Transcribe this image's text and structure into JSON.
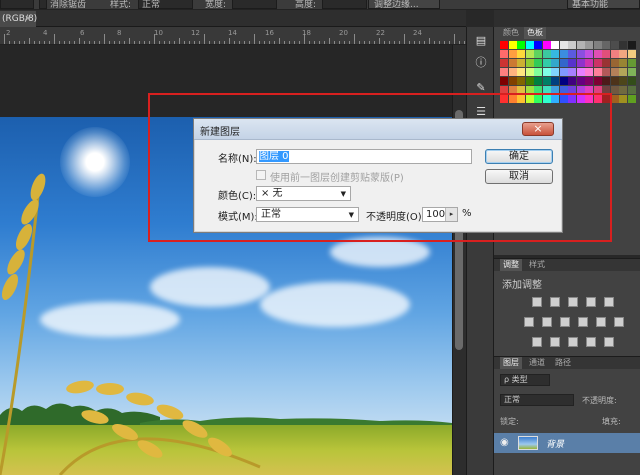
{
  "options_bar": {
    "items": [
      "消除锯齿",
      "样式:",
      "正常",
      "宽度:",
      "高度:",
      "调整边缘...",
      "基本功能"
    ]
  },
  "document": {
    "tab_label": "(RGB/8)",
    "tab_close": "×"
  },
  "ruler": {
    "labels": [
      "2",
      "4",
      "6",
      "8",
      "10",
      "12",
      "14",
      "16",
      "18",
      "20",
      "22",
      "24"
    ]
  },
  "swatch_panel": {
    "tabs": [
      "颜色",
      "色板"
    ],
    "colors": [
      "#ff0000",
      "#ffff00",
      "#00ff00",
      "#00ffff",
      "#0000ff",
      "#ff00ff",
      "#ffffff",
      "#e6e6e6",
      "#cccccc",
      "#b3b3b3",
      "#999999",
      "#808080",
      "#666666",
      "#4d4d4d",
      "#333333",
      "#1a1a1a",
      "#ff6b6b",
      "#ff9f40",
      "#ffd93b",
      "#b5e655",
      "#5fd35f",
      "#3cc8a0",
      "#36b8e0",
      "#3b8de0",
      "#5b5be0",
      "#8b4fe0",
      "#c04fe0",
      "#e04fb5",
      "#e04f7a",
      "#f28080",
      "#f2a680",
      "#f2cc80",
      "#cc3333",
      "#cc7a33",
      "#ccb033",
      "#8fcc33",
      "#33cc57",
      "#33cca8",
      "#33a8cc",
      "#3366cc",
      "#5733cc",
      "#8f33cc",
      "#cc33b0",
      "#cc3366",
      "#993333",
      "#996633",
      "#998533",
      "#669933",
      "#ff8080",
      "#ffb380",
      "#ffe680",
      "#d4ff80",
      "#80ff9c",
      "#80ffe6",
      "#80d4ff",
      "#8099ff",
      "#a680ff",
      "#e680ff",
      "#ff80d4",
      "#ff8099",
      "#b35959",
      "#b38059",
      "#b3a659",
      "#80b359",
      "#800000",
      "#804000",
      "#806600",
      "#408000",
      "#008040",
      "#008066",
      "#004080",
      "#000080",
      "#400080",
      "#660080",
      "#800066",
      "#800033",
      "#4d1a1a",
      "#4d331a",
      "#4d461a",
      "#334d1a",
      "#e04040",
      "#e08040",
      "#e0c040",
      "#a0e040",
      "#40e070",
      "#40e0c0",
      "#40a0e0",
      "#4060e0",
      "#7040e0",
      "#b040e0",
      "#e040c0",
      "#e04080",
      "#704040",
      "#705840",
      "#706a40",
      "#587040",
      "#ff3030",
      "#ff8030",
      "#ffc030",
      "#c0ff30",
      "#30ff60",
      "#30ffd0",
      "#30b0ff",
      "#3050ff",
      "#8030ff",
      "#d030ff",
      "#ff30c0",
      "#ff3070",
      "#a02020",
      "#a06020",
      "#a09020",
      "#60a020"
    ]
  },
  "adjust_panel": {
    "tabs": [
      "调整",
      "样式"
    ],
    "title": "添加调整"
  },
  "layers_panel": {
    "tabs": [
      "图层",
      "通道",
      "路径"
    ],
    "filter_label": "ρ 类型",
    "blend_mode": "正常",
    "opacity_label": "不透明度:",
    "lock_label": "锁定:",
    "fill_label": "填充:",
    "layer_name": "背景"
  },
  "dialog": {
    "title": "新建图层",
    "close": "×",
    "name_label": "名称(N):",
    "name_value": "图层 0",
    "clip_label": "使用前一图层创建剪贴蒙版(P)",
    "color_label": "颜色(C):",
    "color_value": "× 无",
    "mode_label": "模式(M):",
    "mode_value": "正常",
    "opacity_label": "不透明度(O):",
    "opacity_value": "100",
    "opacity_unit": "%",
    "ok": "确定",
    "cancel": "取消"
  }
}
